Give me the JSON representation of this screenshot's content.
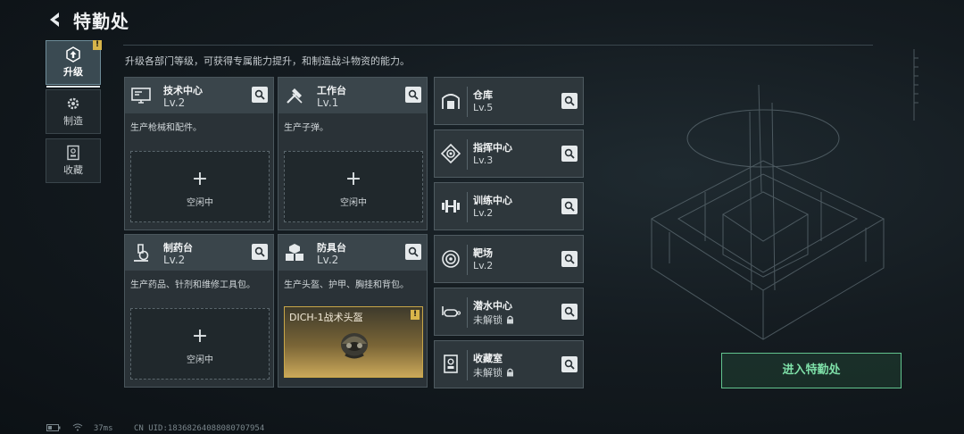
{
  "header": {
    "title": "特勤处",
    "subtitle": "升级各部门等级，可获得专属能力提升，和制造战斗物资的能力。"
  },
  "tabs": [
    {
      "label": "升级",
      "icon": "upgrade-icon",
      "active": true,
      "alert": "!"
    },
    {
      "label": "制造",
      "icon": "gear-icon",
      "active": false
    },
    {
      "label": "收藏",
      "icon": "collection-icon",
      "active": false
    }
  ],
  "departments": [
    {
      "name": "技术中心",
      "level": "Lv.2",
      "icon": "monitor-icon",
      "desc": "生产枪械和配件。",
      "slot": {
        "plus": "+",
        "text": "空闲中"
      }
    },
    {
      "name": "工作台",
      "level": "Lv.1",
      "icon": "tools-icon",
      "desc": "生产子弹。",
      "slot": {
        "plus": "+",
        "text": "空闲中"
      }
    },
    {
      "name": "制药台",
      "level": "Lv.2",
      "icon": "microscope-icon",
      "desc": "生产药品、针剂和维修工具包。",
      "slot": {
        "plus": "+",
        "text": "空闲中"
      }
    },
    {
      "name": "防具台",
      "level": "Lv.2",
      "icon": "armor-icon",
      "desc": "生产头盔、护甲、胸挂和背包。",
      "slot": {
        "item_name": "DICH-1战术头盔",
        "alert": "!"
      }
    }
  ],
  "facilities": [
    {
      "name": "仓库",
      "level": "Lv.5",
      "icon": "warehouse-icon"
    },
    {
      "name": "指挥中心",
      "level": "Lv.3",
      "icon": "chip-icon"
    },
    {
      "name": "训练中心",
      "level": "Lv.2",
      "icon": "dumbbell-icon"
    },
    {
      "name": "靶场",
      "level": "Lv.2",
      "icon": "target-icon"
    },
    {
      "name": "潜水中心",
      "level": "未解锁",
      "icon": "diving-mask-icon",
      "locked": true
    },
    {
      "name": "收藏室",
      "level": "未解锁",
      "icon": "display-case-icon",
      "locked": true
    }
  ],
  "enter_button": "进入特勤处",
  "status": {
    "ping": "37ms",
    "uid": "CN UID:18368264088080707954"
  },
  "colors": {
    "accent_green": "#7ee0a8",
    "alert_yellow": "#d8b54a",
    "gold": "#caa85a"
  }
}
